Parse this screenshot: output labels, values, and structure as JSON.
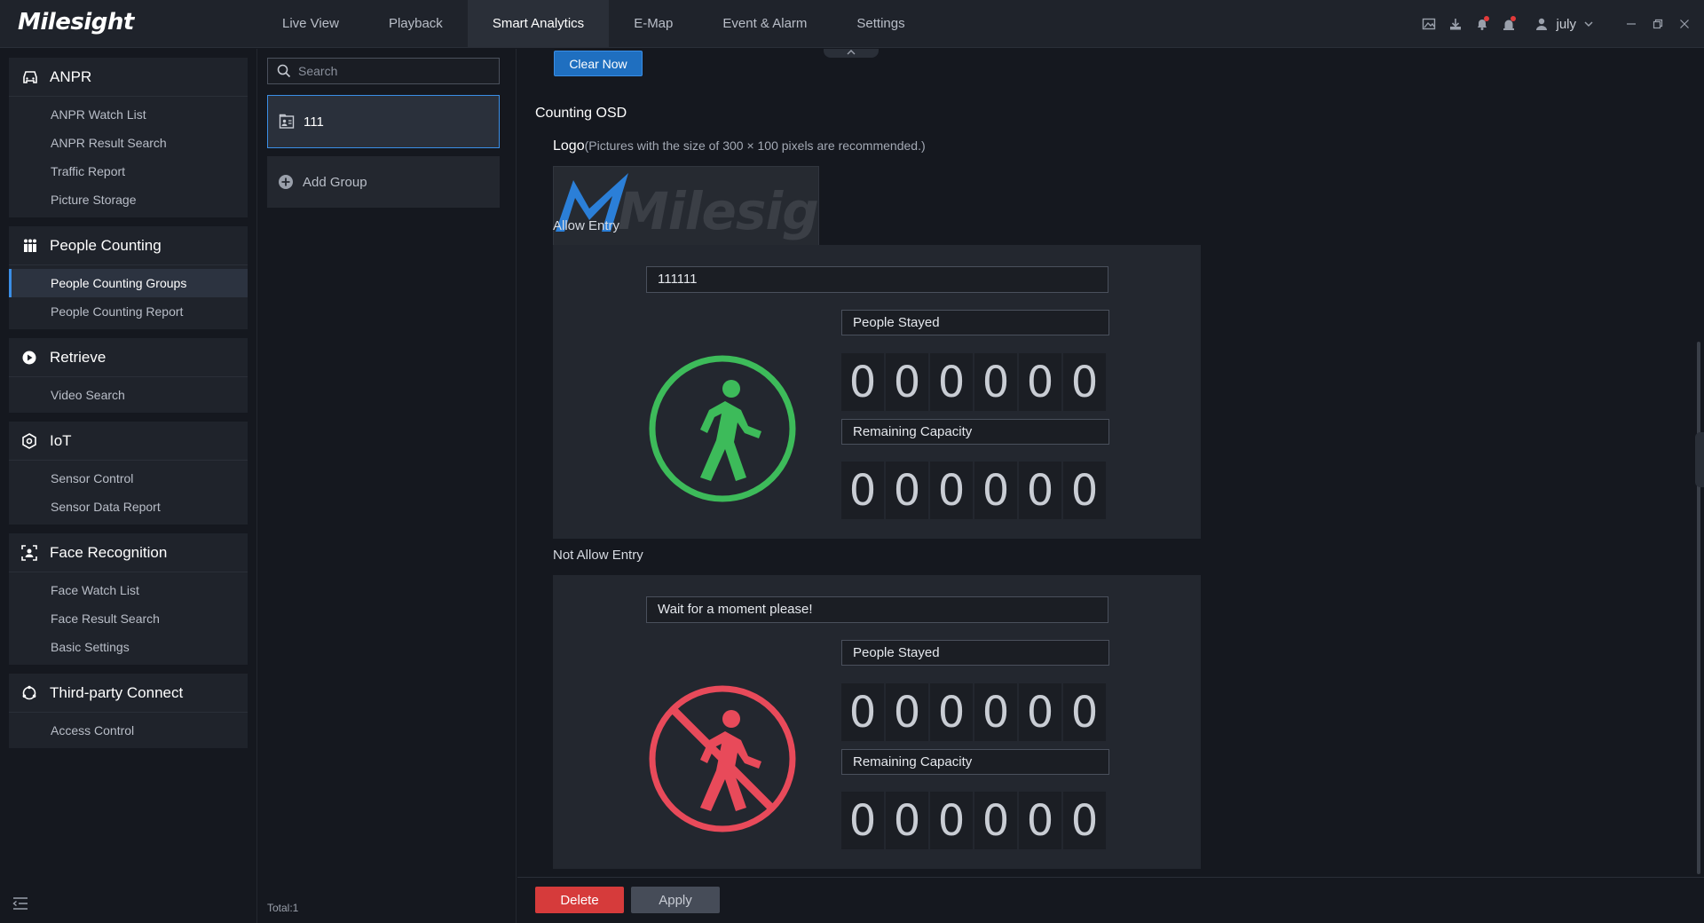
{
  "app": {
    "brand": "Milesight"
  },
  "nav": {
    "tabs": [
      {
        "label": "Live View"
      },
      {
        "label": "Playback"
      },
      {
        "label": "Smart Analytics",
        "active": true
      },
      {
        "label": "E-Map"
      },
      {
        "label": "Event & Alarm"
      },
      {
        "label": "Settings"
      }
    ]
  },
  "header": {
    "user": "july"
  },
  "sidebar": {
    "sections": [
      {
        "title": "ANPR",
        "icon": "car-icon",
        "items": [
          "ANPR Watch List",
          "ANPR Result Search",
          "Traffic Report",
          "Picture Storage"
        ]
      },
      {
        "title": "People Counting",
        "icon": "people-icon",
        "items": [
          "People Counting Groups",
          "People Counting Report"
        ],
        "active_item": "People Counting Groups"
      },
      {
        "title": "Retrieve",
        "icon": "play-circle-icon",
        "items": [
          "Video Search"
        ]
      },
      {
        "title": "IoT",
        "icon": "iot-icon",
        "items": [
          "Sensor Control",
          "Sensor Data Report"
        ]
      },
      {
        "title": "Face Recognition",
        "icon": "face-icon",
        "items": [
          "Face Watch List",
          "Face Result Search",
          "Basic Settings"
        ]
      },
      {
        "title": "Third-party Connect",
        "icon": "connect-icon",
        "items": [
          "Access Control"
        ]
      }
    ]
  },
  "groups": {
    "search_placeholder": "Search",
    "items": [
      {
        "name": "111"
      }
    ],
    "add_label": "Add Group",
    "total": "Total:1"
  },
  "main": {
    "clear_now": "Clear Now",
    "osd_title": "Counting OSD",
    "logo_label": "Logo",
    "logo_hint": "(Pictures with the size of 300 × 100 pixels are recommended.)",
    "logo_image_text": "Milesight",
    "allow": {
      "label": "Allow Entry",
      "message": "111111",
      "stayed_label": "People Stayed",
      "stayed_digits": [
        "0",
        "0",
        "0",
        "0",
        "0",
        "0"
      ],
      "remaining_label": "Remaining Capacity",
      "remaining_digits": [
        "0",
        "0",
        "0",
        "0",
        "0",
        "0"
      ],
      "icon_color": "#3dbb5a"
    },
    "not_allow": {
      "label": "Not Allow Entry",
      "message": "Wait for a moment please!",
      "stayed_label": "People Stayed",
      "stayed_digits": [
        "0",
        "0",
        "0",
        "0",
        "0",
        "0"
      ],
      "remaining_label": "Remaining Capacity",
      "remaining_digits": [
        "0",
        "0",
        "0",
        "0",
        "0",
        "0"
      ],
      "icon_color": "#e84a5a"
    }
  },
  "actions": {
    "delete": "Delete",
    "apply": "Apply"
  },
  "colors": {
    "accent": "#3a8ee6",
    "danger": "#d63b3b",
    "bg": "#15181f",
    "panel": "#23272f"
  }
}
